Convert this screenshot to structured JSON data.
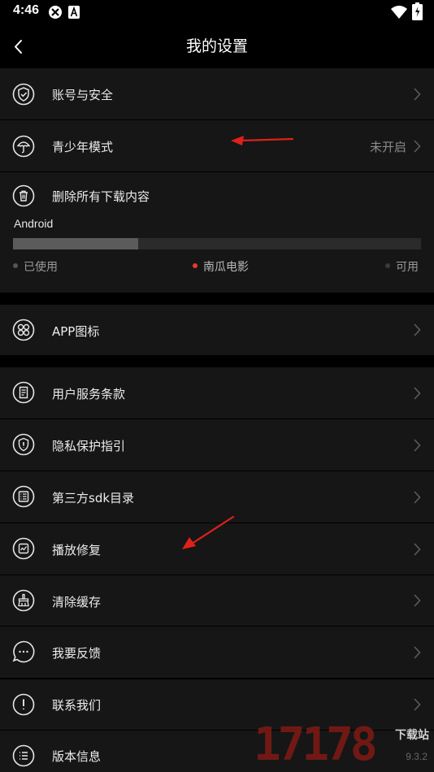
{
  "status_bar": {
    "time": "4:46",
    "icons": [
      "sync-app-icon",
      "a-app-icon",
      "wifi-icon",
      "battery-icon"
    ]
  },
  "header": {
    "title": "我的设置",
    "back_icon": "chevron-left-icon"
  },
  "settings": {
    "account": {
      "label": "账号与安全",
      "icon": "shield-check-icon"
    },
    "teen_mode": {
      "label": "青少年模式",
      "value": "未开启",
      "icon": "umbrella-icon"
    },
    "delete_downloads": {
      "label": "删除所有下载内容",
      "icon": "trash-icon"
    },
    "storage": {
      "title": "Android",
      "used_fraction": 0.306,
      "legend": [
        {
          "label": "已使用",
          "color": "#555555"
        },
        {
          "label": "南瓜电影",
          "color": "#e53935"
        },
        {
          "label": "可用",
          "color": "#3a3a3a"
        }
      ]
    },
    "app_icon": {
      "label": "APP图标",
      "icon": "grid-flower-icon"
    },
    "terms": {
      "label": "用户服务条款",
      "icon": "document-icon"
    },
    "privacy": {
      "label": "隐私保护指引",
      "icon": "privacy-shield-icon"
    },
    "sdk": {
      "label": "第三方sdk目录",
      "icon": "list-icon"
    },
    "repair": {
      "label": "播放修复",
      "icon": "repair-box-icon"
    },
    "clear_cache": {
      "label": "清除缓存",
      "icon": "broom-icon"
    },
    "feedback": {
      "label": "我要反馈",
      "icon": "chat-bubble-icon"
    },
    "contact": {
      "label": "联系我们",
      "icon": "info-exclamation-icon"
    },
    "version": {
      "label": "版本信息",
      "icon": "list-lines-icon"
    }
  },
  "annotations": {
    "arrow_color": "#e0201a"
  },
  "watermark": {
    "number": "17178",
    "site": "下载站",
    "url": "9.3.2"
  }
}
